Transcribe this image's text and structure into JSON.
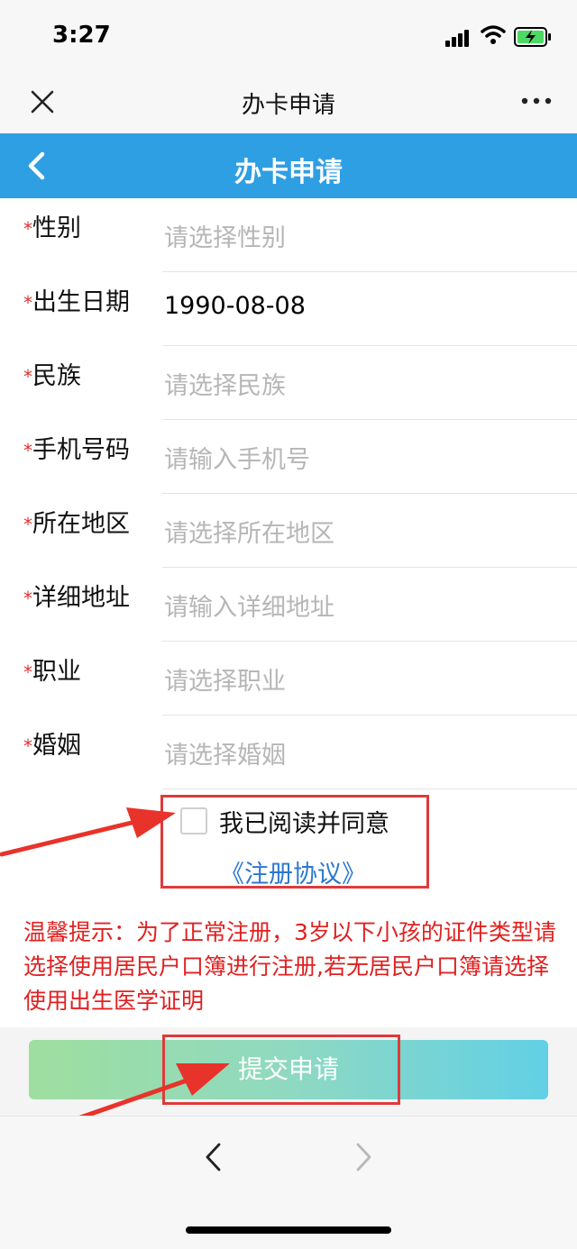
{
  "status": {
    "time": "3:27"
  },
  "nav": {
    "title": "办卡申请"
  },
  "header": {
    "title": "办卡申请"
  },
  "form": {
    "star": "*",
    "rows": [
      {
        "label": "性别",
        "value": "请选择性别",
        "filled": false
      },
      {
        "label": "出生日期",
        "value": "1990-08-08",
        "filled": true
      },
      {
        "label": "民族",
        "value": "请选择民族",
        "filled": false
      },
      {
        "label": "手机号码",
        "value": "请输入手机号",
        "filled": false
      },
      {
        "label": "所在地区",
        "value": "请选择所在地区",
        "filled": false
      },
      {
        "label": "详细地址",
        "value": "请输入详细地址",
        "filled": false
      },
      {
        "label": "职业",
        "value": "请选择职业",
        "filled": false
      },
      {
        "label": "婚姻",
        "value": "请选择婚姻",
        "filled": false
      }
    ]
  },
  "agreement": {
    "text": "我已阅读并同意",
    "link": "《注册协议》",
    "checked": false
  },
  "notice": "温馨提示：为了正常注册，3岁以下小孩的证件类型请选择使用居民户口簿进行注册,若无居民户口簿请选择使用出生医学证明",
  "submit": {
    "label": "提交申请"
  },
  "colors": {
    "header": "#2f9fe3",
    "required": "#e03030",
    "notice": "#e02020",
    "link": "#2b78d0",
    "annotation": "#e03a3a"
  }
}
